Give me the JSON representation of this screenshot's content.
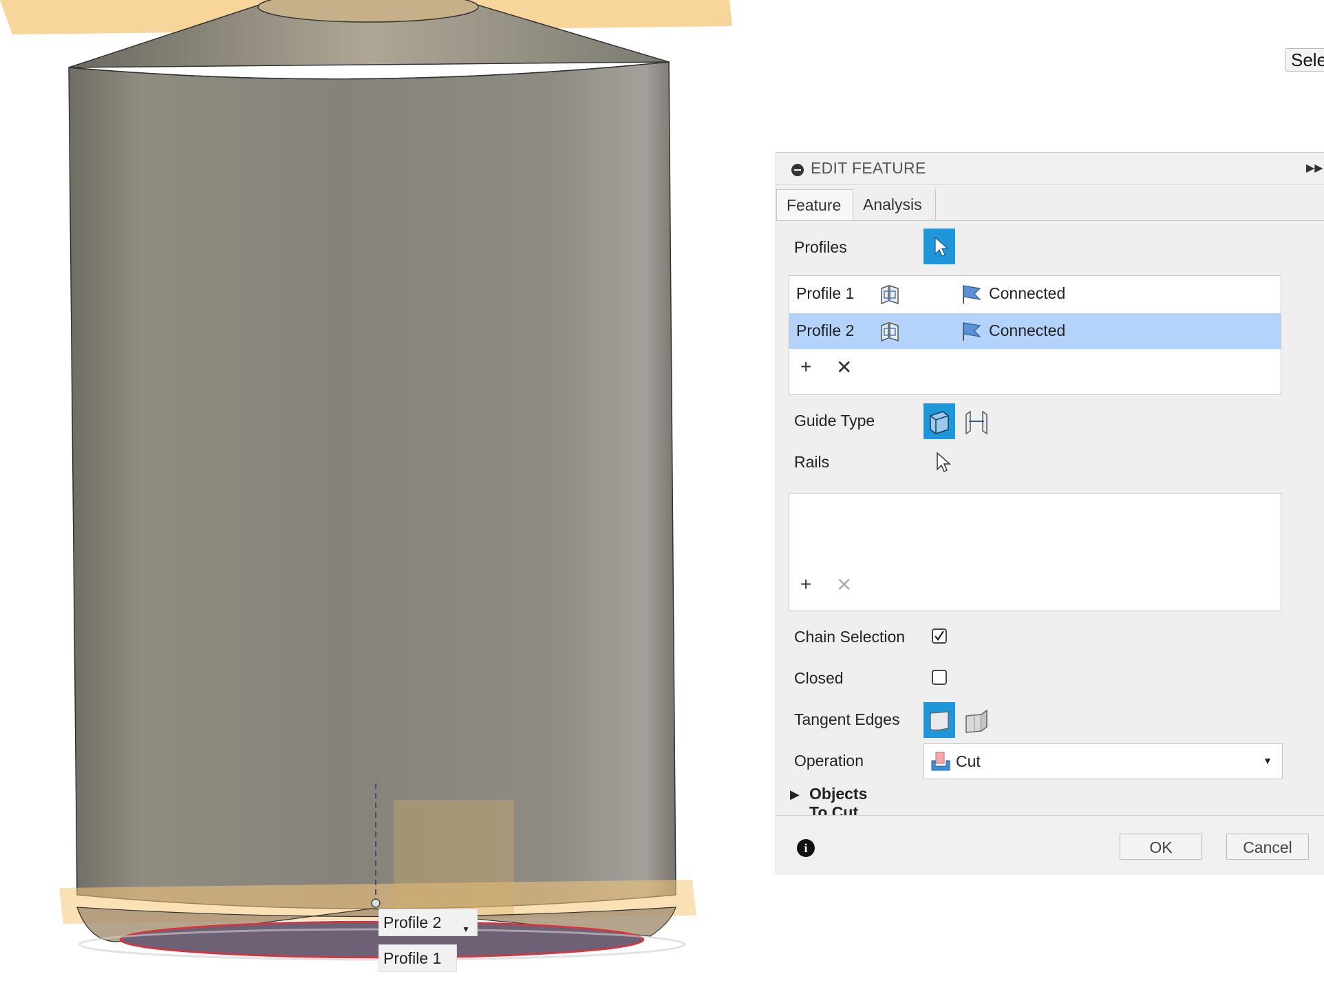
{
  "viewport": {
    "tag_profile2": "Profile 2",
    "tag_profile1": "Profile 1",
    "select_chip": "Sele"
  },
  "dialog": {
    "title": "EDIT FEATURE",
    "tabs": [
      {
        "label": "Feature",
        "active": true
      },
      {
        "label": "Analysis",
        "active": false
      }
    ],
    "profiles_label": "Profiles",
    "profiles": [
      {
        "name": "Profile 1",
        "continuity": "Connected",
        "selected": false
      },
      {
        "name": "Profile 2",
        "continuity": "Connected",
        "selected": true
      }
    ],
    "guide_type_label": "Guide Type",
    "rails_label": "Rails",
    "chain_selection_label": "Chain Selection",
    "chain_selection_checked": true,
    "closed_label": "Closed",
    "closed_checked": false,
    "tangent_edges_label": "Tangent Edges",
    "operation_label": "Operation",
    "operation_value": "Cut",
    "objects_to_cut_label": "Objects To Cut",
    "ok_label": "OK",
    "cancel_label": "Cancel"
  },
  "colors": {
    "accent": "#1e96d9",
    "selected_row": "#b3d3fb",
    "body": "#8a877c",
    "plane": "#f5c778"
  }
}
